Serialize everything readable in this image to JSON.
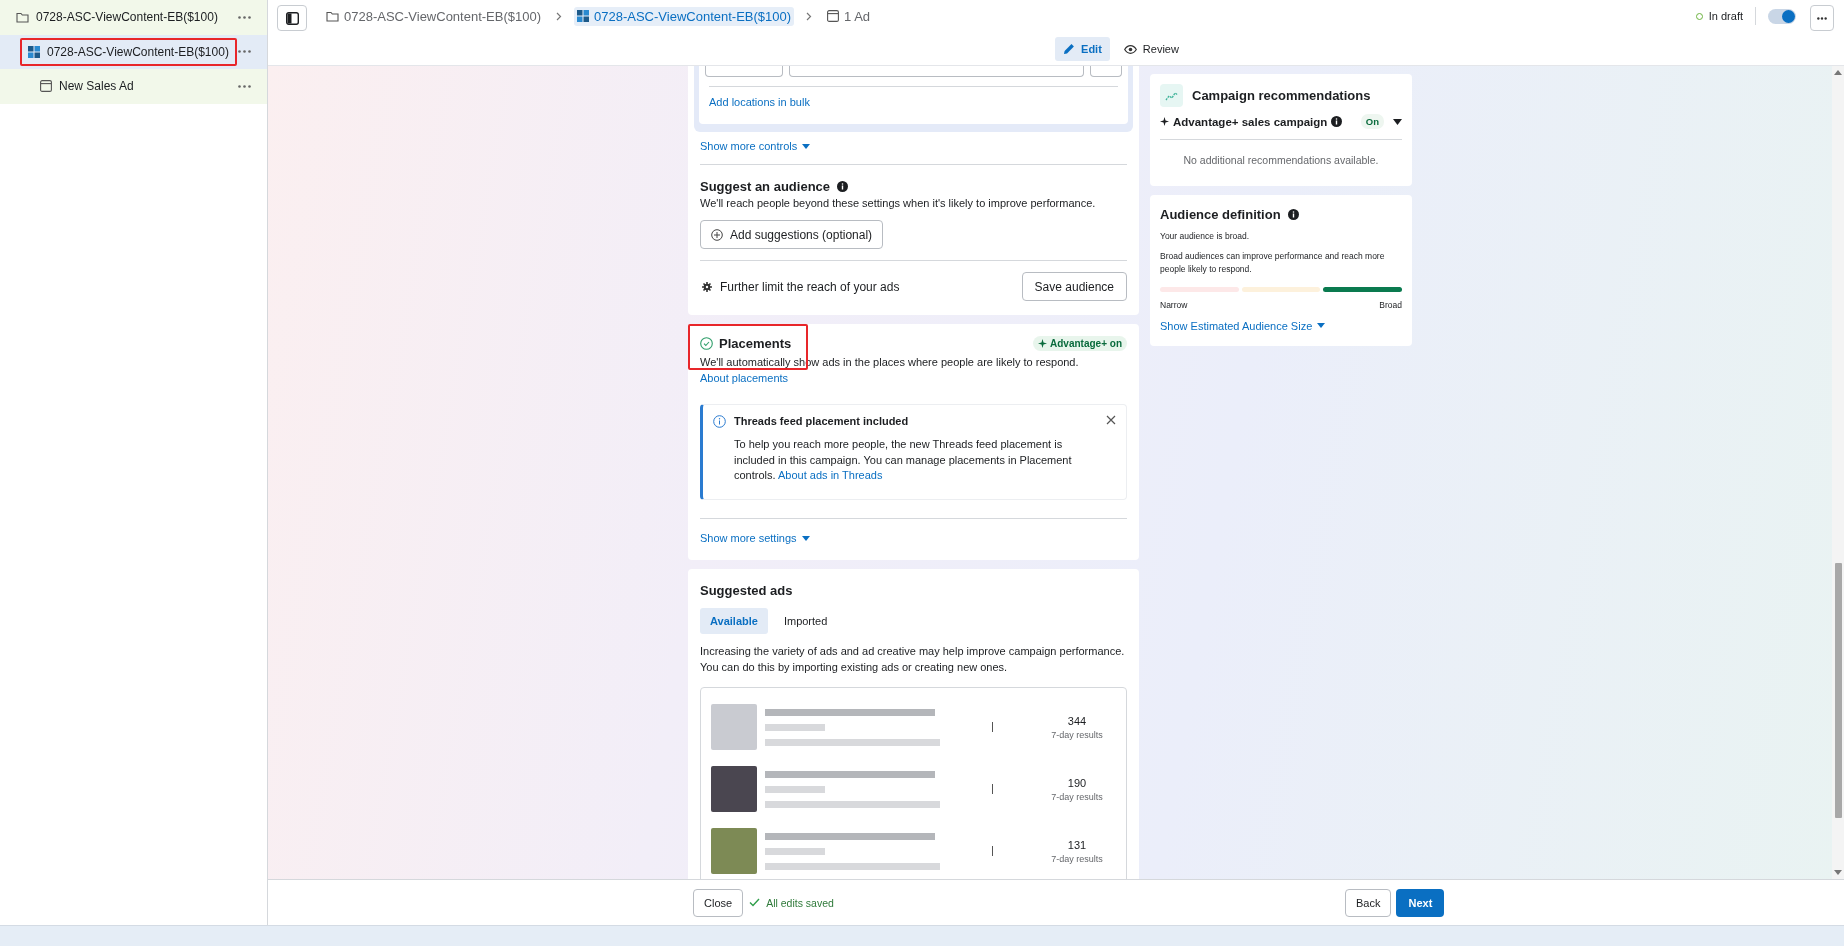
{
  "sidebar": {
    "items": [
      {
        "kind": "campaign",
        "label": "0728-ASC-ViewContent-EB($100)",
        "selected": false,
        "highlighted": false,
        "children": [
          {
            "kind": "adset",
            "label": "0728-ASC-ViewContent-EB($100)",
            "selected": true,
            "highlighted": true,
            "children": [
              {
                "kind": "ad",
                "label": "New Sales Ad",
                "selected": false,
                "highlighted": false
              }
            ]
          }
        ]
      }
    ]
  },
  "breadcrumb": [
    {
      "kind": "campaign",
      "label": "0728-ASC-ViewContent-EB($100)",
      "selected": false
    },
    {
      "kind": "adset",
      "label": "0728-ASC-ViewContent-EB($100)",
      "selected": true
    },
    {
      "kind": "ad",
      "label": "1 Ad",
      "selected": false
    }
  ],
  "view_tabs": [
    {
      "label": "Edit",
      "kind": "edit",
      "selected": true
    },
    {
      "label": "Review",
      "kind": "review",
      "selected": false
    }
  ],
  "status": {
    "label": "In draft",
    "toggle_on": true
  },
  "audience": {
    "add_locations_link": "Add locations in bulk",
    "show_more_controls": "Show more controls",
    "suggest_title": "Suggest an audience",
    "suggest_description": "We'll reach people beyond these settings when it's likely to improve performance.",
    "add_suggestions_button": "Add suggestions (optional)",
    "further_limit_label": "Further limit the reach of your ads",
    "save_audience_button": "Save audience"
  },
  "placements": {
    "title": "Placements",
    "highlighted": true,
    "badge": "Advantage+ on",
    "description": "We'll automatically show ads in the places where people are likely to respond.",
    "about_link": "About placements",
    "notice": {
      "title": "Threads feed placement included",
      "body": "To help you reach more people, the new Threads feed placement is included in this campaign. You can manage placements in Placement controls.",
      "link": "About ads in Threads"
    },
    "show_more_settings": "Show more settings"
  },
  "suggested_ads": {
    "title": "Suggested ads",
    "tabs": [
      {
        "label": "Available",
        "selected": true
      },
      {
        "label": "Imported",
        "selected": false
      }
    ],
    "description": "Increasing the variety of ads and ad creative may help improve campaign performance. You can do this by importing existing ads or creating new ones.",
    "ads": [
      {
        "result": "344",
        "result_label": "7-day results"
      },
      {
        "result": "190",
        "result_label": "7-day results"
      },
      {
        "result": "131",
        "result_label": "7-day results"
      }
    ]
  },
  "recommendations": {
    "title": "Campaign recommendations",
    "advantage_label": "Advantage+ sales campaign",
    "advantage_on": true,
    "status": "On",
    "empty_text": "No additional recommendations available."
  },
  "audience_definition": {
    "title": "Audience definition",
    "summary": "Your audience is broad.",
    "description": "Broad audiences can improve performance and reach more people likely to respond.",
    "segments": [
      {
        "selected": false
      },
      {
        "selected": false
      },
      {
        "selected": true
      }
    ],
    "narrow_label": "Narrow",
    "broad_label": "Broad",
    "size_link": "Show Estimated Audience Size"
  },
  "footer": {
    "close_button": "Close",
    "save_status": "All edits saved",
    "back_button": "Back",
    "next_button": "Next"
  }
}
